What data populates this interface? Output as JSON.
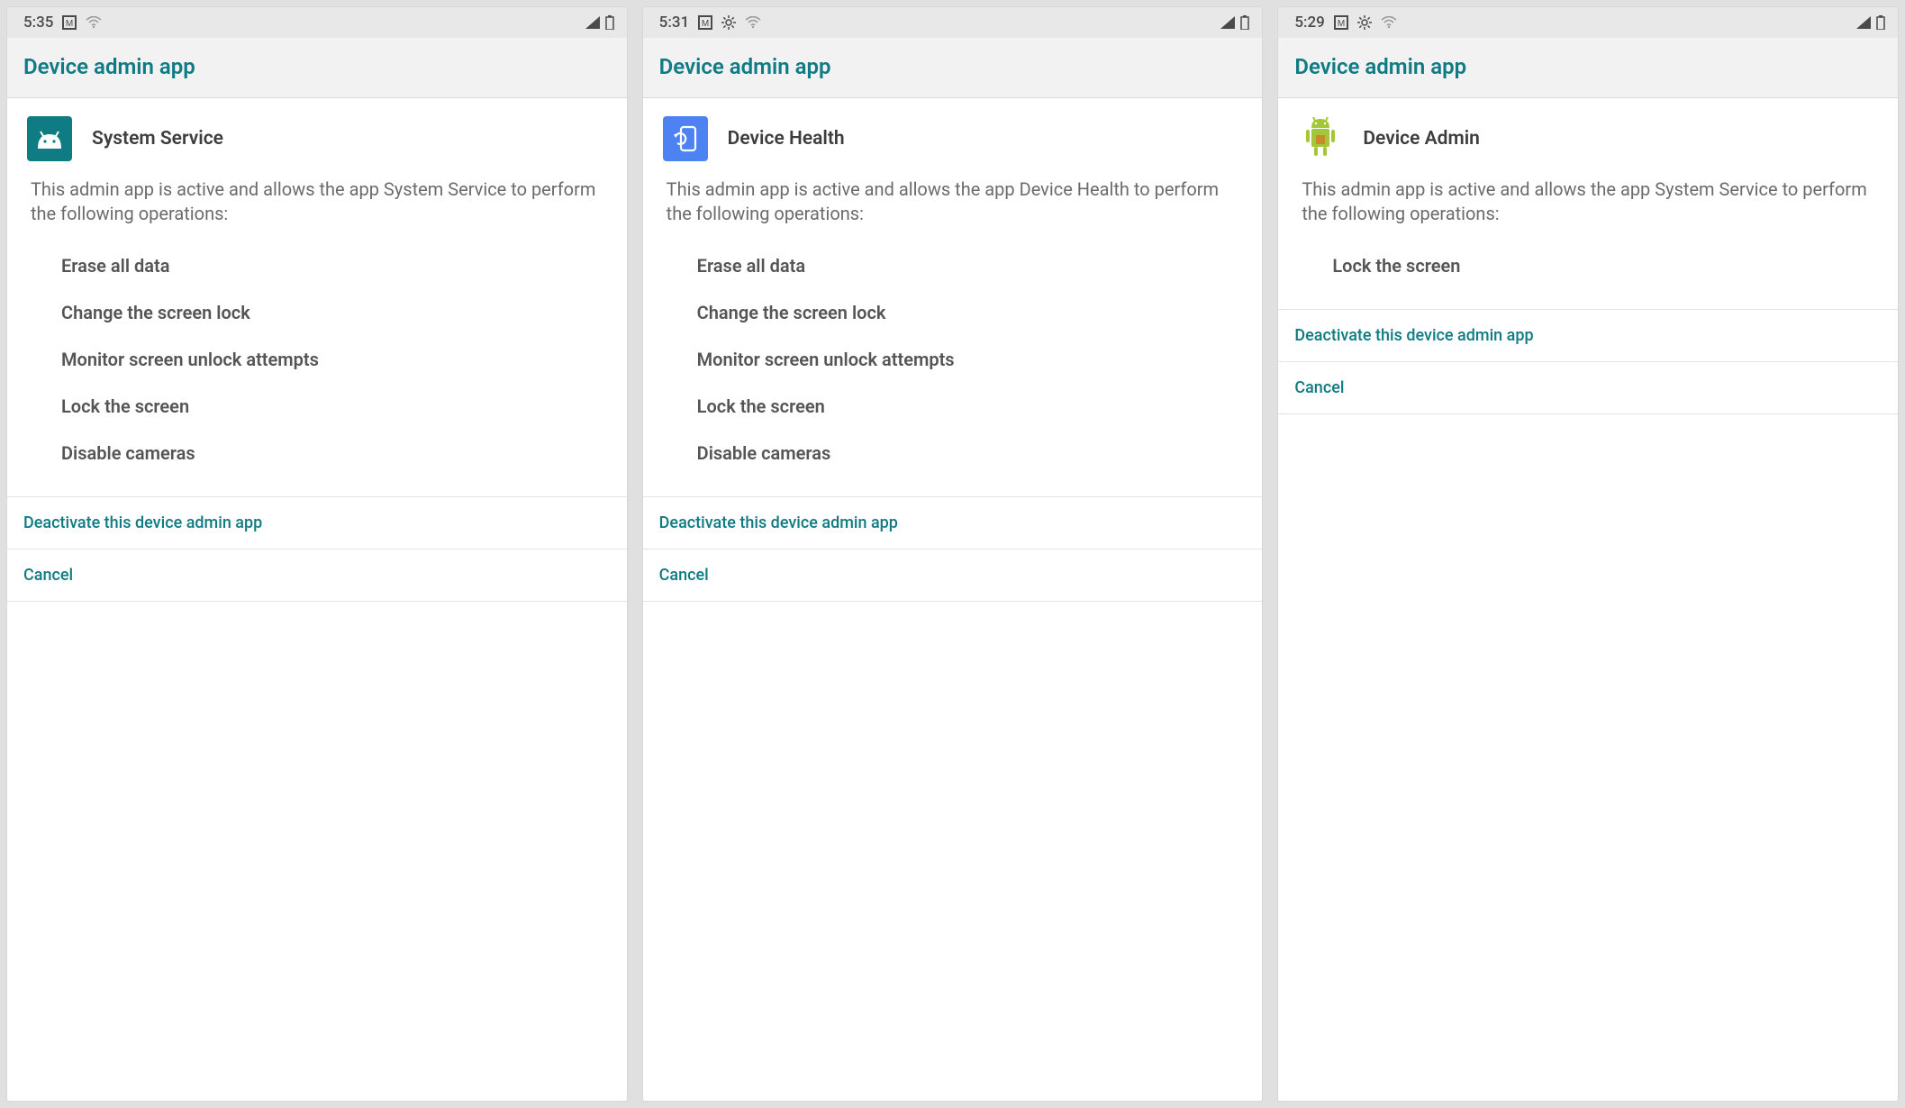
{
  "screens": [
    {
      "status": {
        "time": "5:35",
        "icons": [
          "square-m",
          "wifi"
        ],
        "right": [
          "signal",
          "battery"
        ]
      },
      "header": {
        "title": "Device admin app"
      },
      "app": {
        "name": "System Service",
        "icon": "android-head",
        "iconStyle": "teal"
      },
      "description": "This admin app is active and allows the app System Service to perform the following operations:",
      "permissions": [
        "Erase all data",
        "Change the screen lock",
        "Monitor screen unlock attempts",
        "Lock the screen",
        "Disable cameras"
      ],
      "actions": {
        "deactivate": "Deactivate this device admin app",
        "cancel": "Cancel"
      }
    },
    {
      "status": {
        "time": "5:31",
        "icons": [
          "square-m",
          "gear",
          "wifi"
        ],
        "right": [
          "signal",
          "battery"
        ]
      },
      "header": {
        "title": "Device admin app"
      },
      "app": {
        "name": "Device Health",
        "icon": "phone-refresh",
        "iconStyle": "blue"
      },
      "description": "This admin app is active and allows the app Device Health to perform the following operations:",
      "permissions": [
        "Erase all data",
        "Change the screen lock",
        "Monitor screen unlock attempts",
        "Lock the screen",
        "Disable cameras"
      ],
      "actions": {
        "deactivate": "Deactivate this device admin app",
        "cancel": "Cancel"
      }
    },
    {
      "status": {
        "time": "5:29",
        "icons": [
          "square-m",
          "gear",
          "wifi"
        ],
        "right": [
          "signal",
          "battery"
        ]
      },
      "header": {
        "title": "Device admin app"
      },
      "app": {
        "name": "Device Admin",
        "icon": "android-robot",
        "iconStyle": "white"
      },
      "description": "This admin app is active and allows the app System Service to perform the following operations:",
      "permissions": [
        "Lock the screen"
      ],
      "actions": {
        "deactivate": "Deactivate this device admin app",
        "cancel": "Cancel"
      }
    }
  ]
}
